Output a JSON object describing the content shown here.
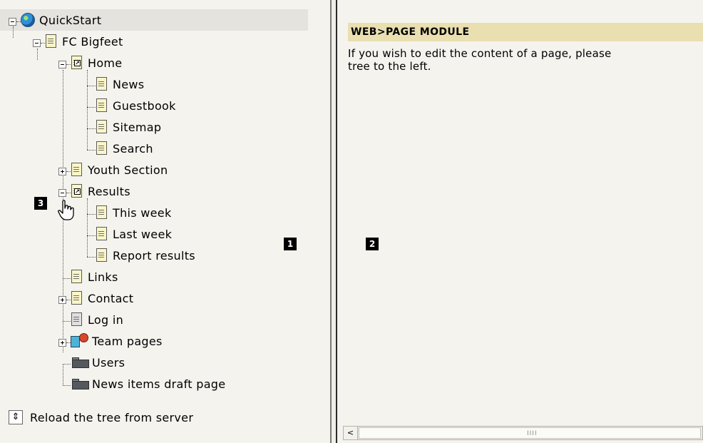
{
  "tree": {
    "root": {
      "label": "QuickStart",
      "icon": "globe-icon"
    },
    "site": {
      "label": "FC Bigfeet",
      "icon": "page-icon"
    },
    "nodes": [
      {
        "label": "Home",
        "icon": "shortcut-page-icon"
      },
      {
        "label": "News",
        "icon": "page-icon"
      },
      {
        "label": "Guestbook",
        "icon": "page-icon"
      },
      {
        "label": "Sitemap",
        "icon": "page-icon"
      },
      {
        "label": "Search",
        "icon": "page-icon"
      },
      {
        "label": "Youth Section",
        "icon": "page-icon"
      },
      {
        "label": "Results",
        "icon": "shortcut-page-icon"
      },
      {
        "label": "This week",
        "icon": "page-icon"
      },
      {
        "label": "Last week",
        "icon": "page-icon"
      },
      {
        "label": "Report results",
        "icon": "page-icon"
      },
      {
        "label": "Links",
        "icon": "page-icon"
      },
      {
        "label": "Contact",
        "icon": "page-icon"
      },
      {
        "label": "Log in",
        "icon": "restricted-page-icon"
      },
      {
        "label": "Team pages",
        "icon": "team-icon"
      },
      {
        "label": "Users",
        "icon": "folder-icon"
      },
      {
        "label": "News items draft page",
        "icon": "folder-icon"
      }
    ],
    "reload_label": "Reload the tree from server"
  },
  "markers": {
    "tree": "1",
    "content": "2",
    "toggle": "3"
  },
  "module": {
    "header": "WEB>PAGE MODULE",
    "text": "If you wish to edit the content of a page, please\ntree to the left."
  },
  "scrollbar": {
    "left_arrow": "<",
    "grip": "IIII"
  },
  "colors": {
    "background": "#f5f3ee",
    "header_bar": "#e9dfb0",
    "selected_row": "#e5e3de"
  }
}
